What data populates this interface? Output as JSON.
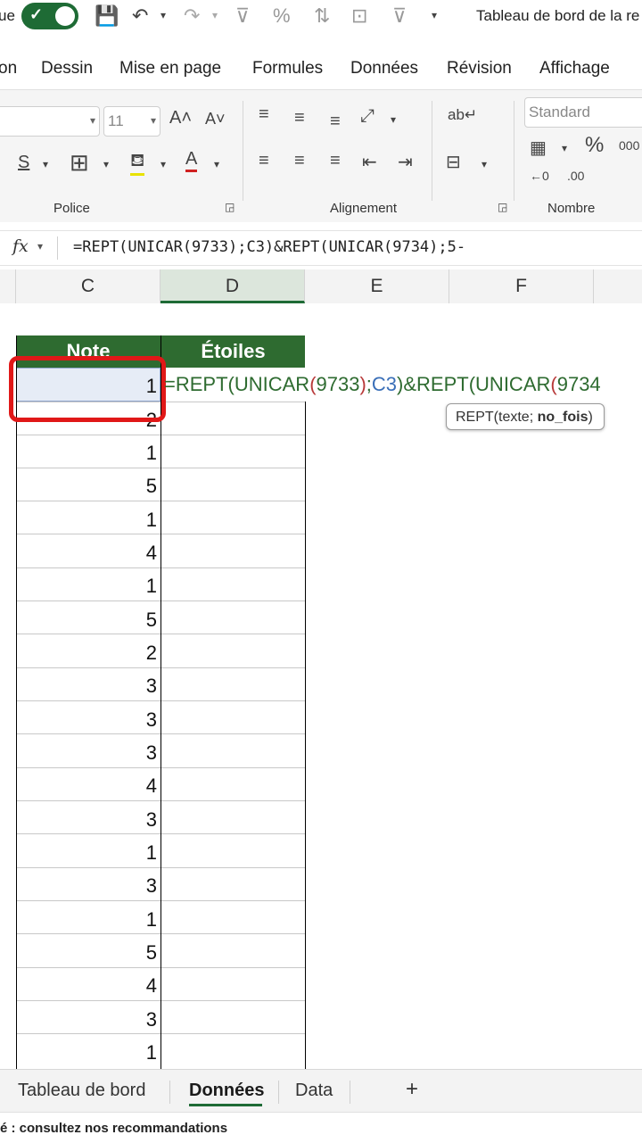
{
  "titlebar": {
    "left_fragment": "ue",
    "title": "Tableau de bord de la re"
  },
  "menu": {
    "items": [
      "on",
      "Dessin",
      "Mise en page",
      "Formules",
      "Données",
      "Révision",
      "Affichage"
    ]
  },
  "ribbon": {
    "font_size": "11",
    "number_format": "Standard",
    "groups": {
      "police": "Police",
      "alignement": "Alignement",
      "nombre": "Nombre"
    }
  },
  "formula_bar": {
    "fx": "fx",
    "formula": "=REPT(UNICAR(9733);C3)&REPT(UNICAR(9734);5-"
  },
  "columns": [
    "C",
    "D",
    "E",
    "F"
  ],
  "table": {
    "header_c": "Note",
    "header_d": "Étoiles",
    "notes": [
      "1",
      "2",
      "1",
      "5",
      "1",
      "4",
      "1",
      "5",
      "2",
      "3",
      "3",
      "3",
      "4",
      "3",
      "1",
      "3",
      "1",
      "5",
      "4",
      "3",
      "1"
    ]
  },
  "edit": {
    "p1": "=REPT(UNICAR",
    "p2": "(",
    "p3": "9733",
    "p4": ")",
    "p5": ";",
    "p6": "C3",
    "p7": ")&REPT(UNICAR",
    "p8": "(",
    "p9": "9734"
  },
  "tooltip": {
    "pre": "REPT(texte; ",
    "bold": "no_fois",
    "post": ")"
  },
  "tabs": [
    "Tableau de bord",
    "Données",
    "Data"
  ],
  "add_sheet": "+",
  "status": "é : consultez nos recommandations",
  "colors": {
    "accent": "#1e6b35",
    "header_fill": "#2e6b30",
    "highlight": "#e01818",
    "ref_blue": "#3a6fb8",
    "paren_red": "#b83a3a"
  }
}
